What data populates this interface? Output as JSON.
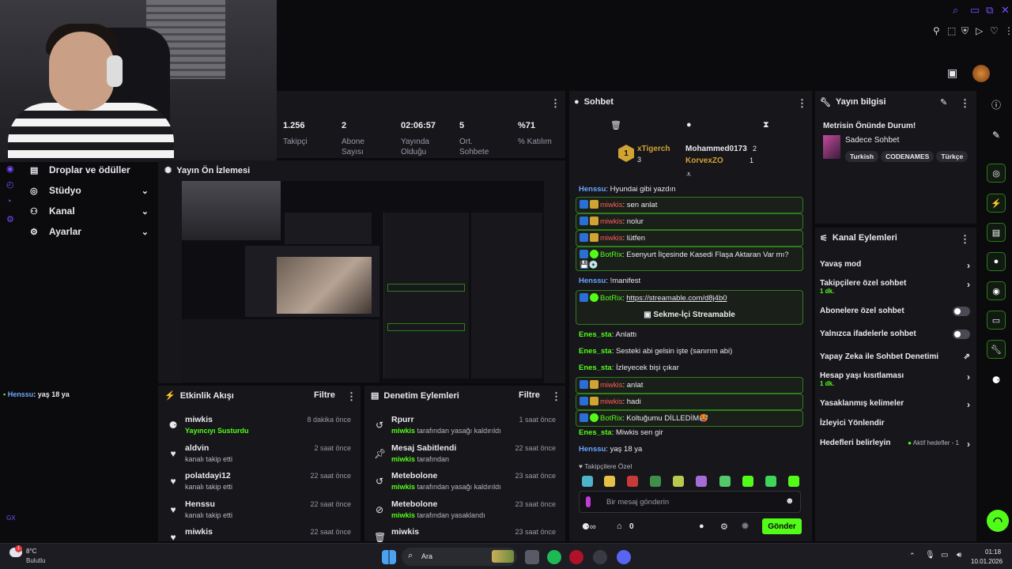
{
  "window": {
    "controls": [
      "search-icon",
      "restore-icon",
      "maximize-icon",
      "heart-icon"
    ],
    "toolbar_icons": [
      "pin-icon",
      "crop-icon",
      "shield-icon",
      "play-icon",
      "heart-outline-icon",
      "more-vert-icon"
    ]
  },
  "stats": [
    {
      "value": "1.256",
      "label": "Takipçi"
    },
    {
      "value": "2",
      "label": "Abone Sayısı"
    },
    {
      "value": "02:06:57",
      "label": "Yayında Olduğu"
    },
    {
      "value": "5",
      "label": "Ort. Sohbete"
    },
    {
      "value": "%71",
      "label": "% Katılım"
    }
  ],
  "nav": {
    "items": [
      {
        "label": "Droplar ve ödüller"
      },
      {
        "label": "Stüdyo"
      },
      {
        "label": "Kanal"
      },
      {
        "label": "Ayarlar"
      }
    ],
    "footer_label": "GX",
    "bottom_message_user": "Henssu",
    "bottom_message_text": ": yaş 18 ya"
  },
  "preview": {
    "title": "Yayın Ön İzlemesi"
  },
  "activity": {
    "title": "Etkinlik Akışı",
    "filter": "Filtre",
    "rows": [
      {
        "name": "miwkis",
        "sub_hl": "Yayıncıyı Susturdu",
        "sub": "",
        "time": "8 dakika önce"
      },
      {
        "name": "aldvin",
        "sub_hl": "",
        "sub": "kanalı takip etti",
        "time": "2 saat önce"
      },
      {
        "name": "polatdayi12",
        "sub_hl": "",
        "sub": "kanalı takip etti",
        "time": "22 saat önce"
      },
      {
        "name": "Henssu",
        "sub_hl": "",
        "sub": "kanalı takip etti",
        "time": "22 saat önce"
      },
      {
        "name": "miwkis",
        "sub_hl": "",
        "sub": "",
        "time": "22 saat önce"
      }
    ]
  },
  "moderation": {
    "title": "Denetim Eylemleri",
    "filter": "Filtre",
    "rows": [
      {
        "name": "Rpurr",
        "sub_hl": "miwkis",
        "sub": " tarafından yasağı kaldırıldı",
        "time": "1 saat önce"
      },
      {
        "name": "Mesaj Sabitlendi",
        "sub_hl": "miwkis",
        "sub": " tarafından",
        "time": "22 saat önce"
      },
      {
        "name": "Metebolone",
        "sub_hl": "miwkis",
        "sub": " tarafından yasağı kaldırıldı",
        "time": "23 saat önce"
      },
      {
        "name": "Metebolone",
        "sub_hl": "miwkis",
        "sub": " tarafından yasaklandı",
        "time": "23 saat önce"
      },
      {
        "name": "miwkis",
        "sub_hl": "",
        "sub": "",
        "time": "23 saat önce"
      }
    ]
  },
  "chat": {
    "title": "Sohbet",
    "leaderboard": [
      {
        "rank": "1",
        "name": "xTigerch",
        "count": "3"
      },
      {
        "rank": "",
        "name": "Mohammed0173",
        "count": "2"
      },
      {
        "rank": "",
        "name": "KorvexZO",
        "count": "1"
      }
    ],
    "messages": [
      {
        "user": "Henssu",
        "text": ": Hyundai gibi yazdın"
      },
      {
        "user": "miwkis",
        "text": ": sen anlat"
      },
      {
        "user": "miwkis",
        "text": ": nolur"
      },
      {
        "user": "miwkis",
        "text": ": lütfen"
      },
      {
        "user": "BotRix",
        "text": ": Esenyurt İlçesinde Kasedi Flaşa Aktaran Var mı? 💾💿"
      },
      {
        "user": "Henssu",
        "text": ": !manifest"
      },
      {
        "user": "BotRix",
        "text": ": ",
        "link": "https://streamable.com/d8j4b0",
        "button": "Sekme-İçi Streamable"
      },
      {
        "user": "Enes_sta",
        "text": ": Anlattı"
      },
      {
        "user": "Enes_sta",
        "text": ": Sesteki abi gelsin işte (sanırım abi)"
      },
      {
        "user": "Enes_sta",
        "text": ": İzleyecek bişi çıkar"
      },
      {
        "user": "miwkis",
        "text": ": anlat"
      },
      {
        "user": "miwkis",
        "text": ": hadi"
      },
      {
        "user": "BotRix",
        "text": ": Koltuğumu DİLLEDİM🥵"
      },
      {
        "user": "Enes_sta",
        "text": ": Miwkis sen gir"
      },
      {
        "user": "Henssu",
        "text": ": yaş 18 ya"
      }
    ],
    "followers_only_label": "Takipçilere Özel",
    "input_placeholder": "Bir mesaj gönderin",
    "points": "0",
    "send_label": "Gönder"
  },
  "info": {
    "title": "Yayın bilgisi",
    "stream_title": "Metrisin Önünde Durum!",
    "category": "Sadece Sohbet",
    "tags": [
      "Turkish",
      "CODENAMES",
      "Türkçe"
    ]
  },
  "actions": {
    "title": "Kanal Eylemleri",
    "items": [
      {
        "label": "Yavaş mod",
        "sub": "",
        "kind": "chevron"
      },
      {
        "label": "Takipçilere özel sohbet",
        "sub": "1 dk.",
        "kind": "chevron"
      },
      {
        "label": "Abonelere özel sohbet",
        "sub": "",
        "kind": "toggle"
      },
      {
        "label": "Yalnızca ifadelerle sohbet",
        "sub": "",
        "kind": "toggle"
      },
      {
        "label": "Yapay Zeka ile Sohbet Denetimi",
        "sub": "",
        "kind": "external"
      },
      {
        "label": "Hesap yaşı kısıtlaması",
        "sub": "1 dk.",
        "kind": "chevron"
      },
      {
        "label": "Yasaklanmış kelimeler",
        "sub": "",
        "kind": "chevron"
      },
      {
        "label": "İzleyici Yönlendir",
        "sub": "",
        "kind": "none"
      },
      {
        "label": "Hedefleri belirleyin",
        "sub": "",
        "kind": "goal",
        "extra": "Aktif hedefler - 1"
      }
    ]
  },
  "taskbar": {
    "weather_temp": "8°C",
    "weather_desc": "Bulutlu",
    "search_label": "Ara",
    "time": "01:18",
    "date": "10.01.2026",
    "notification_badge": "1"
  },
  "colors": {
    "accent": "#53fc18",
    "purple": "#7c4dff",
    "panel": "#16161b"
  }
}
